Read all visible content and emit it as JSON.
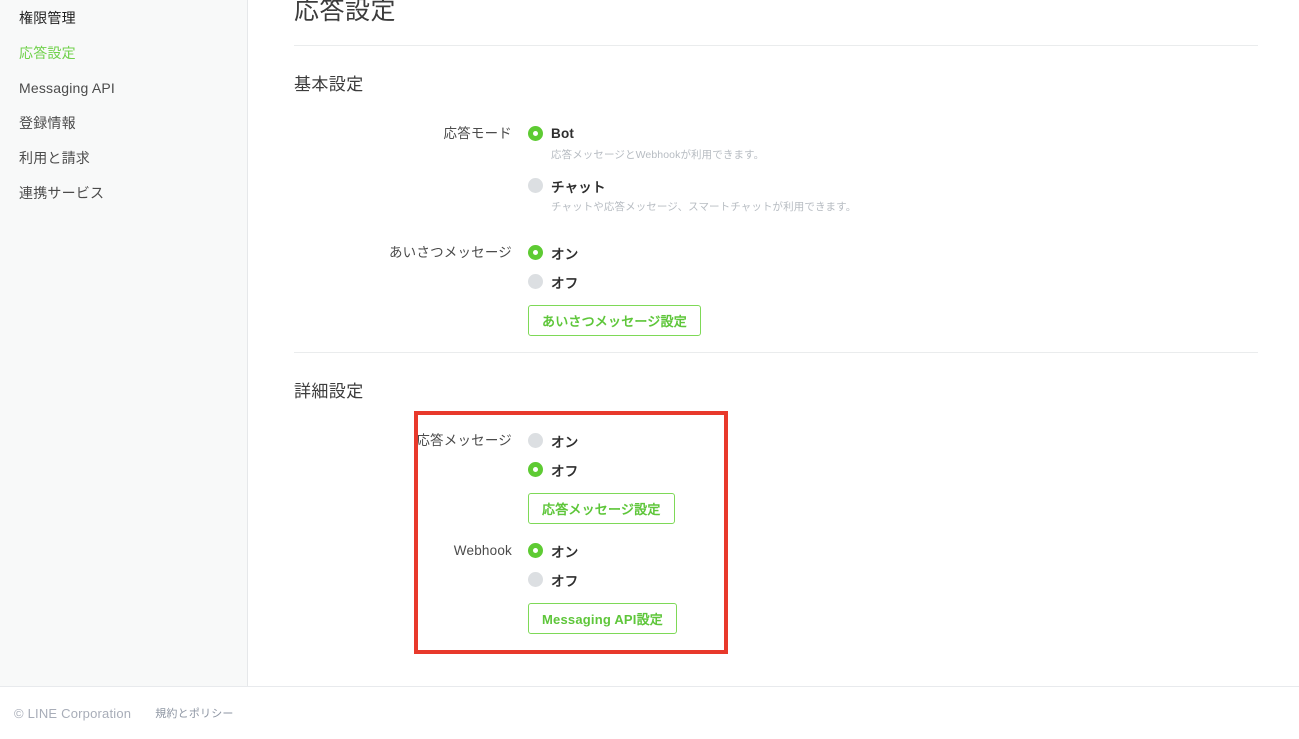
{
  "sidebar": {
    "items": [
      {
        "label": "権限管理",
        "active": false
      },
      {
        "label": "応答設定",
        "active": true
      },
      {
        "label": "Messaging API",
        "active": false
      },
      {
        "label": "登録情報",
        "active": false
      },
      {
        "label": "利用と請求",
        "active": false
      },
      {
        "label": "連携サービス",
        "active": false
      }
    ]
  },
  "main": {
    "page_title": "応答設定",
    "sections": {
      "basic": {
        "title": "基本設定",
        "response_mode": {
          "label": "応答モード",
          "options": [
            {
              "label": "Bot",
              "selected": true,
              "description": "応答メッセージとWebhookが利用できます。"
            },
            {
              "label": "チャット",
              "selected": false,
              "description": "チャットや応答メッセージ、スマートチャットが利用できます。"
            }
          ]
        },
        "greeting_message": {
          "label": "あいさつメッセージ",
          "options": [
            {
              "label": "オン",
              "selected": true
            },
            {
              "label": "オフ",
              "selected": false
            }
          ],
          "button": "あいさつメッセージ設定"
        }
      },
      "detail": {
        "title": "詳細設定",
        "reply_message": {
          "label": "応答メッセージ",
          "options": [
            {
              "label": "オン",
              "selected": false
            },
            {
              "label": "オフ",
              "selected": true
            }
          ],
          "button": "応答メッセージ設定"
        },
        "webhook": {
          "label": "Webhook",
          "options": [
            {
              "label": "オン",
              "selected": true
            },
            {
              "label": "オフ",
              "selected": false
            }
          ],
          "button": "Messaging API設定"
        }
      }
    }
  },
  "footer": {
    "copyright": "© LINE Corporation",
    "policy_link": "規約とポリシー"
  },
  "colors": {
    "accent_green": "#5ecb33",
    "button_green": "#5ec63a",
    "highlight_red": "#e8392b",
    "sidebar_bg": "#f8f9f9",
    "text_primary": "#3c3c3c",
    "text_muted": "#b7bcc2"
  }
}
